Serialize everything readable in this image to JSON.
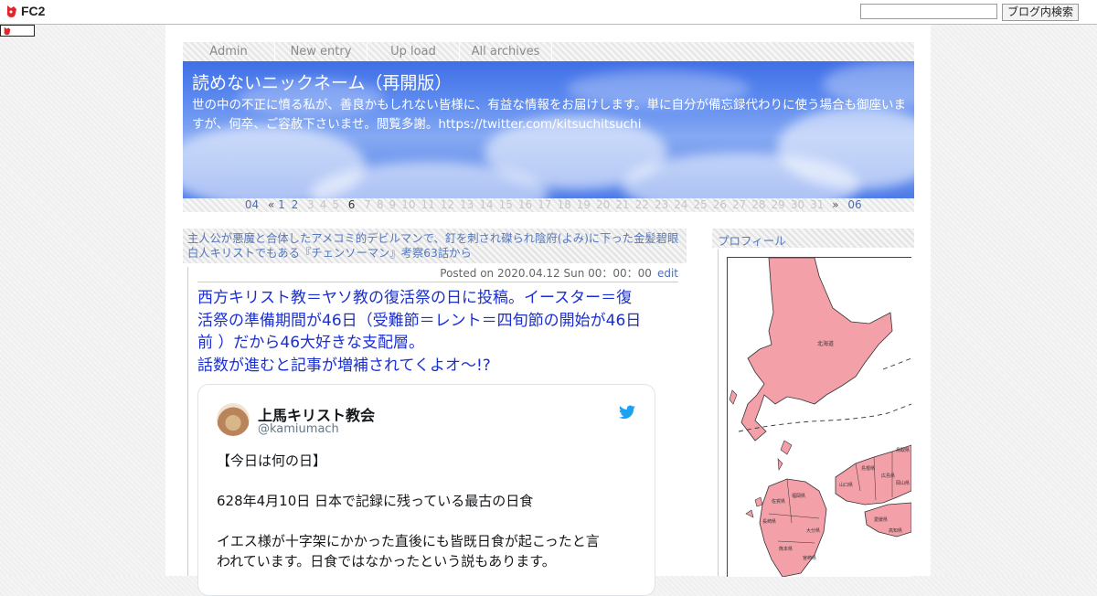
{
  "fc2": {
    "logo_text": "FC2",
    "search_placeholder": "",
    "search_button": "ブログ内検索"
  },
  "nav": {
    "items": [
      "Admin",
      "New entry",
      "Up load",
      "All archives"
    ]
  },
  "blog": {
    "title": "読めないニックネーム（再開版）",
    "description": "世の中の不正に憤る私が、善良かもしれない皆様に、有益な情報をお届けします。単に自分が備忘録代わりに使う場合も御座いますが、何卒、ご容赦下さいませ。閲覧多謝。https://twitter.com/kitsuchitsuchi"
  },
  "calendar": {
    "prev_month": "04",
    "prev_arrow": "«",
    "active_days": [
      "1",
      "2"
    ],
    "dim_days_a": [
      "3",
      "4",
      "5"
    ],
    "current_day": "6",
    "dim_days_b": [
      "7",
      "8",
      "9",
      "10",
      "11",
      "12",
      "13",
      "14",
      "15",
      "16",
      "17",
      "18",
      "19",
      "20",
      "21",
      "22",
      "23",
      "24",
      "25",
      "26",
      "27",
      "28",
      "29",
      "30",
      "31"
    ],
    "next_arrow": "»",
    "next_month": "06"
  },
  "entry": {
    "title": "主人公が悪魔と合体したアメコミ的デビルマンで、釘を刺され磔られ陰府(よみ)に下った金髪碧眼白人キリストでもある『チェンソーマン』考察63話から",
    "posted": "Posted on 2020.04.12 Sun 00：00：00",
    "edit_label": "edit",
    "headline_lines": [
      "西方キリスト教＝ヤソ教の復活祭の日に投稿。イースター＝復",
      "活祭の準備期間が46日（受難節＝レント＝四旬節の開始が46日",
      "前 ）だから46大好きな支配層。",
      "話数が進むと記事が増補されてくよオ～!?"
    ]
  },
  "tweet": {
    "name": "上馬キリスト教会",
    "handle": "@kamiumach",
    "lines": [
      "【今日は何の日】",
      "628年4月10日 日本で記録に残っている最古の日食",
      "イエス様が十字架にかかった直後にも皆既日食が起こったと言",
      "われています。日食ではなかったという説もあります。"
    ],
    "bird_color": "#1da1f2"
  },
  "sidebar": {
    "title": "プロフィール",
    "map_labels": [
      "北海道",
      "山口県",
      "島根県",
      "広島県",
      "鳥取県",
      "岡山県",
      "福岡県",
      "佐賀県",
      "長崎県",
      "大分県",
      "宮崎県",
      "熊本県",
      "愛媛県",
      "高知県"
    ]
  }
}
